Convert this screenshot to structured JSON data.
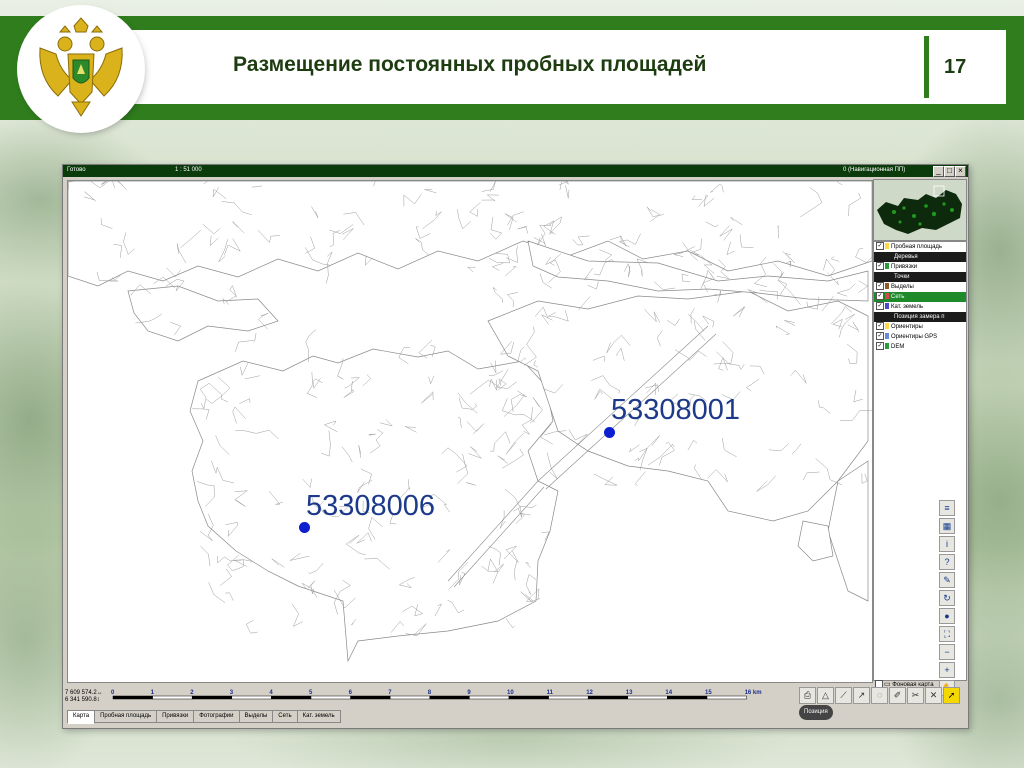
{
  "slide": {
    "title": "Размещение постоянных пробных площадей",
    "page_number": "17",
    "colors": {
      "brand_green": "#2f7d1d",
      "title_text": "#1d3c10",
      "marker_blue": "#0c1fd0"
    },
    "emblem_icon": "double-headed-eagle-emblem"
  },
  "app": {
    "status": "Готово",
    "scale": "1 : 51 000",
    "nav_status": "0 (Навигационная ПП)",
    "window_buttons": [
      "_",
      "□",
      "×"
    ],
    "coords": {
      "x": "7 609 574.2↔",
      "y": "6 341 590.8↕"
    },
    "scale_ticks": [
      "0",
      "1",
      "2",
      "3",
      "4",
      "5",
      "6",
      "7",
      "8",
      "9",
      "10",
      "11",
      "12",
      "13",
      "14",
      "15",
      "16 km"
    ],
    "map_points": [
      {
        "label": "53308001"
      },
      {
        "label": "53308006"
      }
    ],
    "layers": [
      {
        "label": "Пробная площадь",
        "checked": true,
        "type": "item"
      },
      {
        "label": "Деревья",
        "type": "section"
      },
      {
        "label": "Привязки",
        "checked": true,
        "type": "item"
      },
      {
        "label": "Точки",
        "type": "section"
      },
      {
        "label": "Выделы",
        "checked": true,
        "type": "item"
      },
      {
        "label": "Сеть",
        "checked": true,
        "type": "selected"
      },
      {
        "label": "Кат. земель",
        "checked": true,
        "type": "item"
      },
      {
        "label": "Позиция замера п",
        "type": "section"
      },
      {
        "label": "Ориентиры",
        "checked": true,
        "type": "item"
      },
      {
        "label": "Ориентиры GPS",
        "checked": true,
        "type": "item"
      },
      {
        "label": "DEM",
        "checked": true,
        "type": "item"
      }
    ],
    "background_layer": "Фоновая карта",
    "position_button": "Позиция",
    "tabs": [
      "Карта",
      "Пробная площадь",
      "Привязки",
      "Фотографии",
      "Выделы",
      "Сеть",
      "Кат. земель"
    ],
    "active_tab": "Карта",
    "right_tools": [
      "layers-icon",
      "table-icon",
      "info-icon",
      "help-pointer-icon",
      "measure-icon",
      "refresh-icon",
      "globe-icon",
      "extent-icon",
      "zoom-out-icon",
      "zoom-in-icon",
      "pan-hand-icon"
    ],
    "bottom_tools": [
      "print-icon",
      "triangle-icon",
      "ruler-icon",
      "arrow-tool-icon",
      "select-icon",
      "edit-icon",
      "cut-icon",
      "delete-icon",
      "pointer-yellow-icon"
    ]
  }
}
